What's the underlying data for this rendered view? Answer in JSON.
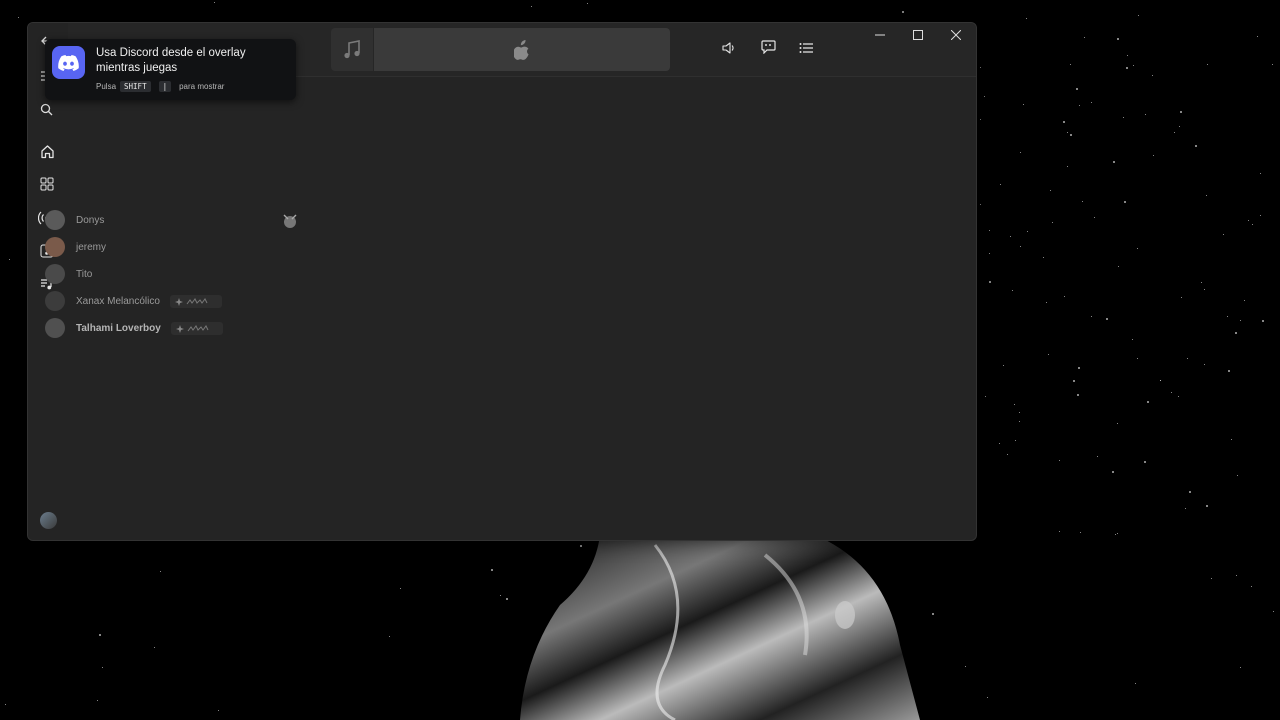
{
  "overlay": {
    "title": "Usa Discord desde el overlay mientras juegas",
    "hint_prefix": "Pulsa",
    "key_1": "SHIFT",
    "key_2": "|",
    "hint_suffix": "para mostrar"
  },
  "friends": [
    {
      "name": "Donys",
      "bold": false,
      "has_tag": false
    },
    {
      "name": "jeremy",
      "bold": false,
      "has_tag": false
    },
    {
      "name": "Tito",
      "bold": false,
      "has_tag": false
    },
    {
      "name": "Xanax Melancólico",
      "bold": false,
      "has_tag": true
    },
    {
      "name": "Talhami Loverboy",
      "bold": true,
      "has_tag": true
    }
  ],
  "icons": {
    "back": "back-arrow-icon",
    "menu": "hamburger-menu-icon",
    "search": "search-icon",
    "home": "home-icon",
    "apps": "apps-grid-icon",
    "broadcast": "broadcast-icon",
    "music_library": "music-library-icon",
    "playlist": "playlist-icon",
    "music_note": "music-note-icon",
    "apple": "apple-logo-icon",
    "volume": "volume-icon",
    "lyrics": "lyrics-icon",
    "queue": "queue-list-icon",
    "minimize": "minimize-icon",
    "maximize": "maximize-icon",
    "close": "close-icon",
    "discord": "discord-logo-icon"
  },
  "colors": {
    "window_bg": "#242424",
    "discord_brand": "#5865f2",
    "desktop_bg": "#000000"
  }
}
